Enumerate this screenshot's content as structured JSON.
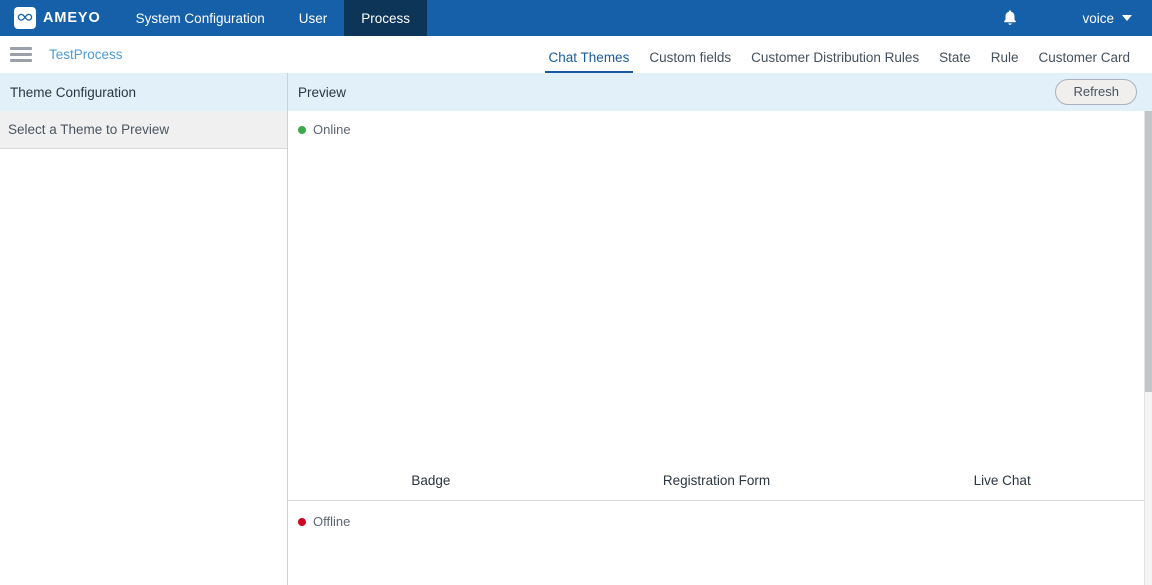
{
  "topbar": {
    "brand": {
      "logo_icon": "infinity-logo-icon",
      "name": "AMEYO"
    },
    "nav": [
      {
        "label": "System Configuration",
        "active": false
      },
      {
        "label": "User",
        "active": false
      },
      {
        "label": "Process",
        "active": true
      }
    ],
    "notification_icon": "bell-icon",
    "user_menu": {
      "label": "voice",
      "chevron_icon": "chevron-down-icon"
    },
    "background_color": "#1560a8",
    "active_tab_color": "#0d3558"
  },
  "subbar": {
    "menu_icon": "hamburger-menu-icon",
    "breadcrumb": "TestProcess",
    "breadcrumb_color": "#4f9ad6",
    "tabs": [
      {
        "label": "Chat Themes",
        "active": true
      },
      {
        "label": "Custom fields",
        "active": false
      },
      {
        "label": "Customer Distribution Rules",
        "active": false
      },
      {
        "label": "State",
        "active": false
      },
      {
        "label": "Rule",
        "active": false
      },
      {
        "label": "Customer Card",
        "active": false
      }
    ],
    "active_tab_color": "#1a5a9e"
  },
  "left_panel": {
    "header_title": "Theme Configuration",
    "header_bg": "#e2f1f9",
    "theme_row_label": "Select a Theme to Preview"
  },
  "preview_panel": {
    "header_title": "Preview",
    "refresh_button": "Refresh",
    "online": {
      "label": "Online",
      "dot_color": "#3aab4a"
    },
    "offline": {
      "label": "Offline",
      "dot_color": "#d1021b"
    },
    "column_labels": [
      "Badge",
      "Registration Form",
      "Live Chat"
    ]
  }
}
